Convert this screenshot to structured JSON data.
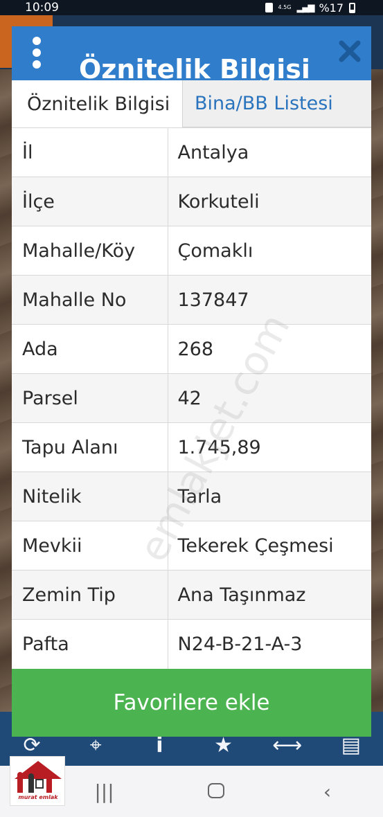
{
  "status_bar": {
    "time": "10:09",
    "network": "4.5G",
    "battery": "%17"
  },
  "dialog": {
    "title": "Öznitelik Bilgisi",
    "tabs": [
      {
        "label": "Öznitelik Bilgisi",
        "active": true
      },
      {
        "label": "Bina/BB Listesi",
        "active": false
      }
    ],
    "rows": [
      {
        "key": "İl",
        "value": "Antalya"
      },
      {
        "key": "İlçe",
        "value": "Korkuteli"
      },
      {
        "key": "Mahalle/Köy",
        "value": "Çomaklı"
      },
      {
        "key": "Mahalle No",
        "value": "137847"
      },
      {
        "key": "Ada",
        "value": "268"
      },
      {
        "key": "Parsel",
        "value": "42"
      },
      {
        "key": "Tapu Alanı",
        "value": "1.745,89"
      },
      {
        "key": "Nitelik",
        "value": "Tarla"
      },
      {
        "key": "Mevkii",
        "value": "Tekerek Çeşmesi"
      },
      {
        "key": "Zemin Tip",
        "value": "Ana Taşınmaz"
      },
      {
        "key": "Pafta",
        "value": "N24-B-21-A-3"
      }
    ],
    "favorite_label": "Favorilere ekle"
  },
  "watermark": "emlakjet.com",
  "logo_text": "murat emlak",
  "colors": {
    "header": "#2f7dcb",
    "favorite": "#4bb34f",
    "tab_link": "#2a73bd",
    "toolbar": "#1f4a78"
  },
  "icons": {
    "toolbar": [
      "refresh-icon",
      "locate-icon",
      "info-icon",
      "star-icon",
      "measure-icon",
      "print-icon"
    ],
    "nav": [
      "recent-apps-icon",
      "home-icon",
      "back-icon"
    ]
  }
}
